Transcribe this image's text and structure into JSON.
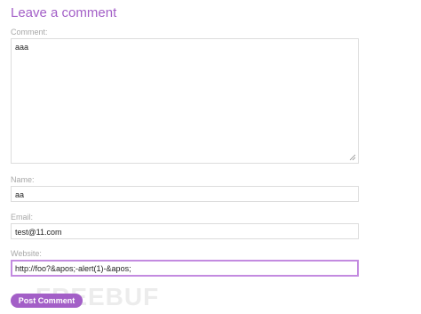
{
  "form": {
    "heading": "Leave a comment",
    "comment": {
      "label": "Comment:",
      "value": "aaa"
    },
    "name": {
      "label": "Name:",
      "value": "aa"
    },
    "email": {
      "label": "Email:",
      "value": "test@11.com"
    },
    "website": {
      "label": "Website:",
      "value": "http://foo?&apos;-alert(1)-&apos;"
    },
    "submit_label": "Post Comment"
  },
  "watermark": {
    "text": "FREEBUF"
  },
  "colors": {
    "accent": "#a35fc7",
    "focus_border": "#c38be0",
    "label": "#a8a8a8",
    "field_border": "#dcdcdc"
  },
  "icons": {
    "resize_grip": "resize-grip-icon"
  }
}
